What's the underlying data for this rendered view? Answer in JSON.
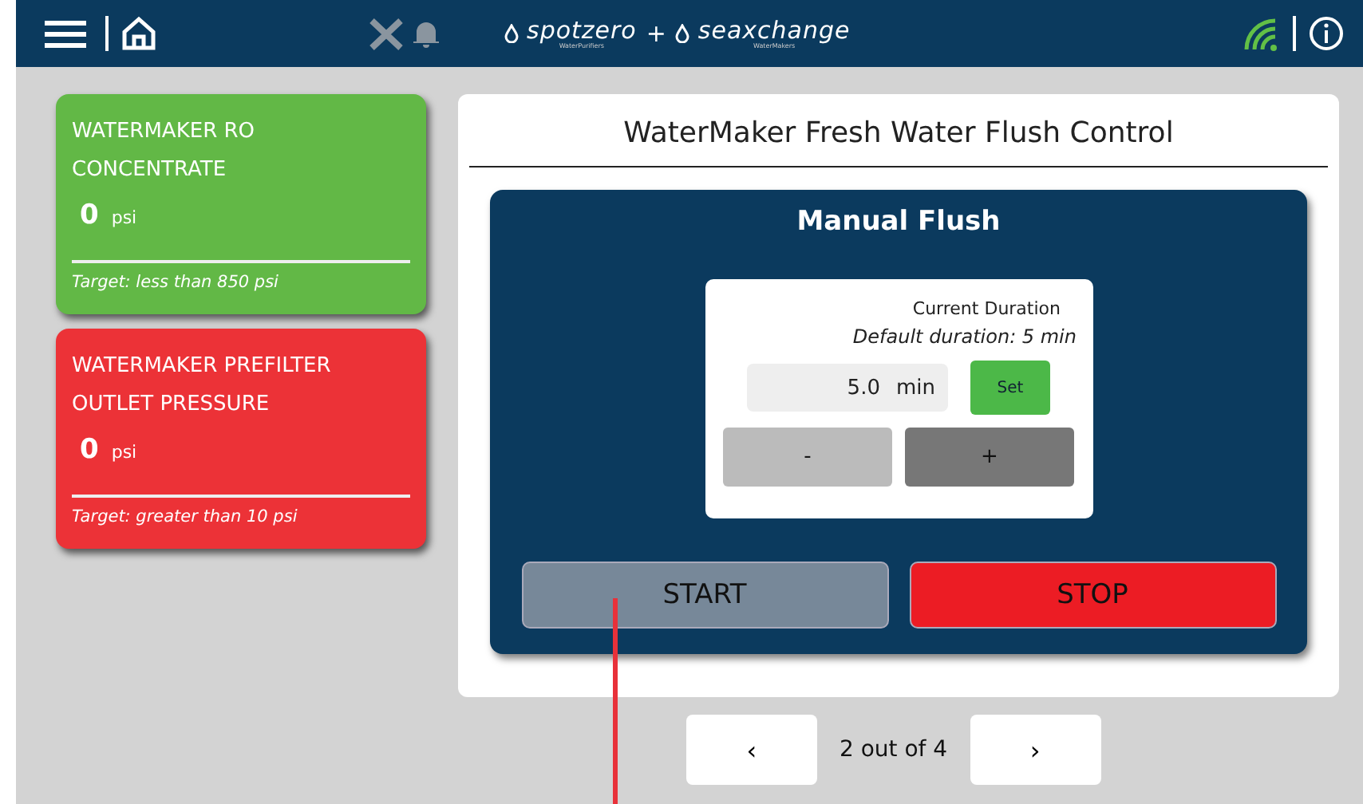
{
  "header": {
    "logos": [
      {
        "name": "spotzero",
        "sub": "WaterPurifiers"
      },
      {
        "name": "seaxchange",
        "sub": "WaterMakers"
      }
    ],
    "joiner": "+"
  },
  "cards": [
    {
      "title": "WATERMAKER RO CONCENTRATE",
      "value": "0",
      "unit": "psi",
      "target": "Target: less than 850 psi",
      "color": "#62b846"
    },
    {
      "title": "WATERMAKER PREFILTER OUTLET PRESSURE",
      "value": "0",
      "unit": "psi",
      "target": "Target: greater than 10 psi",
      "color": "#ec3237"
    }
  ],
  "panel": {
    "title": "WaterMaker Fresh Water Flush Control",
    "section": "Manual Flush",
    "duration": {
      "label": "Current Duration",
      "default": "Default duration: 5 min",
      "value": "5.0",
      "unit": "min",
      "set": "Set",
      "minus": "-",
      "plus": "+"
    },
    "start": "START",
    "stop": "STOP"
  },
  "pager": {
    "prev": "‹",
    "text": "2 out of 4",
    "next": "›"
  },
  "annotation": {
    "leader": true
  }
}
